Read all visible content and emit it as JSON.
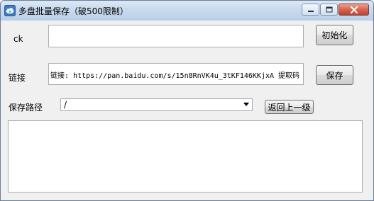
{
  "window": {
    "title": "多盘批量保存（破500限制）",
    "icons": {
      "app": "cloud-app-icon",
      "minimize": "minimize-icon",
      "maximize": "maximize-icon",
      "close": "close-icon"
    }
  },
  "form": {
    "ck": {
      "label": "ck",
      "value": "",
      "button_label": "初始化"
    },
    "link": {
      "label": "链接",
      "value": "链接: https://pan.baidu.com/s/15n8RnVK4u_3tKF146KKjxA 提取码",
      "button_label": "保存"
    },
    "save_path": {
      "label": "保存路径",
      "selected": "/",
      "button_label": "返回上一级"
    },
    "log": {
      "value": ""
    }
  },
  "colors": {
    "titlebar": "#c9daee",
    "close_button": "#d7654f",
    "window_bg": "#f0f0f0"
  }
}
